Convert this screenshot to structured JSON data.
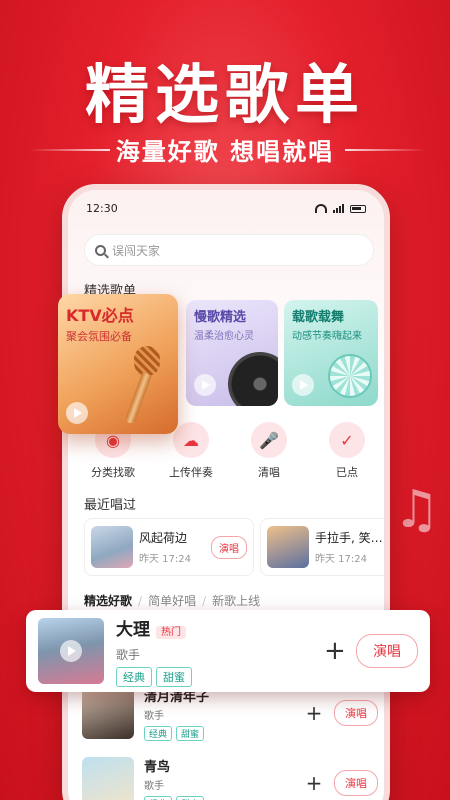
{
  "hero": {
    "title": "精选歌单",
    "subtitle": "海量好歌 想唱就唱"
  },
  "status": {
    "time": "12:30"
  },
  "search": {
    "placeholder": "误闯天家"
  },
  "featured": {
    "title": "精选歌单",
    "cards": [
      {
        "title": "KTV必点",
        "subtitle": "聚会氛围必备"
      },
      {
        "title": "慢歌精选",
        "subtitle": "温柔治愈心灵"
      },
      {
        "title": "载歌载舞",
        "subtitle": "动感节奏嗨起来"
      }
    ]
  },
  "quick_actions": [
    {
      "label": "分类找歌",
      "icon": "music-tag-icon"
    },
    {
      "label": "上传伴奏",
      "icon": "upload-cloud-icon"
    },
    {
      "label": "清唱",
      "icon": "microphone-icon"
    },
    {
      "label": "已点",
      "icon": "clipboard-check-icon"
    }
  ],
  "recent": {
    "title": "最近唱过",
    "items": [
      {
        "name": "风起荷边",
        "time": "昨天 17:24",
        "button": "演唱"
      },
      {
        "name": "手拉手, 笑…",
        "time": "昨天 17:24"
      }
    ]
  },
  "tabs": [
    "精选好歌",
    "简单好唱",
    "新歌上线"
  ],
  "songs": [
    {
      "name": "清月清年子",
      "artist": "歌手",
      "tags": [
        "经典",
        "甜蜜"
      ],
      "button": "演唱"
    },
    {
      "name": "青鸟",
      "artist": "歌手",
      "tags": [
        "经典",
        "甜蜜"
      ],
      "button": "演唱"
    }
  ],
  "highlight": {
    "name": "大理",
    "badge": "热门",
    "artist": "歌手",
    "tags": [
      "经典",
      "甜蜜"
    ],
    "button": "演唱"
  },
  "colors": {
    "accent": "#e8353f",
    "tag": "#1a9f8a",
    "background": "#e3202c"
  }
}
